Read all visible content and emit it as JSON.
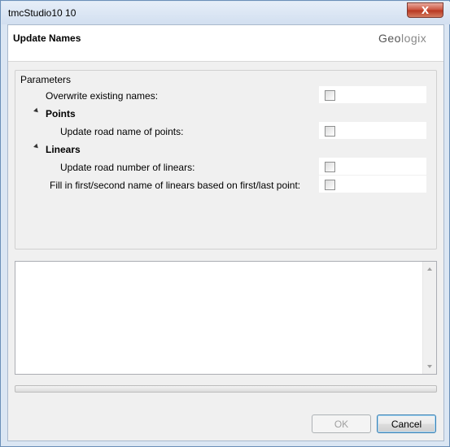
{
  "window": {
    "title": "tmcStudio10 10",
    "close_symbol": "X"
  },
  "header": {
    "title": "Update Names",
    "brand_part1": "Geo",
    "brand_part2": "logix"
  },
  "parameters": {
    "legend": "Parameters",
    "overwrite_label": "Overwrite existing names:",
    "overwrite_checked": false,
    "groups": [
      {
        "label": "Points",
        "items": [
          {
            "label": "Update road name of points:",
            "checked": false
          }
        ]
      },
      {
        "label": "Linears",
        "items": [
          {
            "label": "Update road number of linears:",
            "checked": false
          },
          {
            "label": "Fill in first/second name of linears based on first/last point:",
            "checked": false
          }
        ]
      }
    ]
  },
  "progress": {
    "value": 0
  },
  "buttons": {
    "ok": "OK",
    "cancel": "Cancel"
  },
  "colors": {
    "titlebar": "#d2dff0",
    "close_button": "#c9503b",
    "default_button_border": "#3c7fb1"
  }
}
